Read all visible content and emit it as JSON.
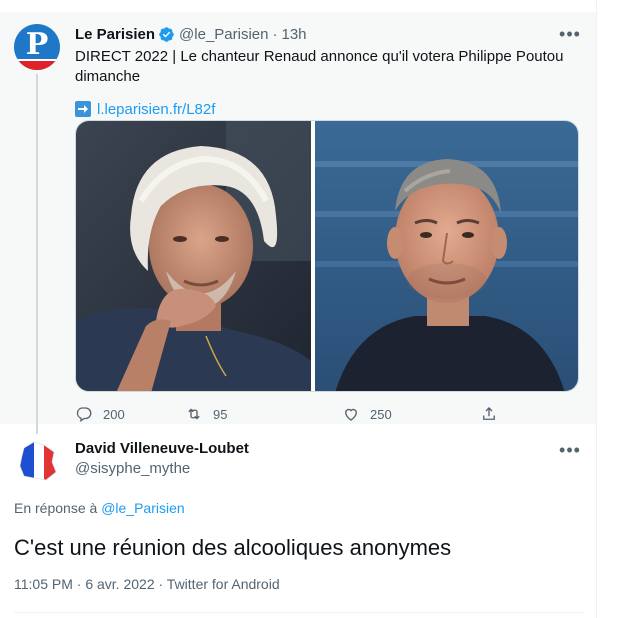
{
  "parent_tweet": {
    "author_name": "Le Parisien",
    "handle": "@le_Parisien",
    "separator": "·",
    "time": "13h",
    "avatar_letter": "P",
    "text": "DIRECT 2022 | Le chanteur Renaud annonce qu'il votera Philippe Poutou dimanche",
    "link_text": "l.leparisien.fr/L82f",
    "more_icon": "more-horizontal-icon",
    "verified_icon": "verified-badge-icon",
    "stats": {
      "replies": "200",
      "retweets": "95",
      "likes": "250"
    }
  },
  "reply_tweet": {
    "author_name": "David Villeneuve-Loubet",
    "handle": "@sisyphe_mythe",
    "in_reply_prefix": "En réponse à",
    "in_reply_mention": "@le_Parisien",
    "text": "C'est une réunion des alcooliques anonymes",
    "meta": "11:05 PM · 6 avr. 2022 · Twitter for Android",
    "more_icon": "more-horizontal-icon"
  },
  "colors": {
    "accent": "#1d9bf0",
    "secondary_text": "#536471",
    "primary_text": "#0f1419",
    "parent_background": "#f7f9f9",
    "le_parisien_blue": "#1f78c7",
    "le_parisien_red": "#e0232b"
  }
}
